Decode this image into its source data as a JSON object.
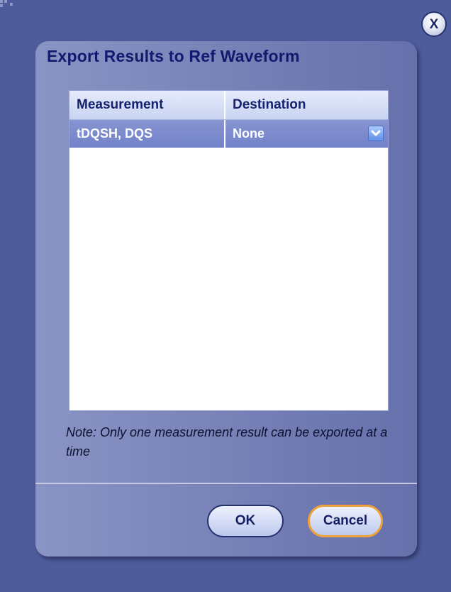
{
  "dialog": {
    "title": "Export Results to Ref Waveform",
    "close_label": "X"
  },
  "table": {
    "headers": [
      "Measurement",
      "Destination"
    ],
    "rows": [
      {
        "measurement": "tDQSH, DQS",
        "destination": "None"
      }
    ]
  },
  "note": "Note: Only one measurement result can be exported at a time",
  "buttons": {
    "ok": "OK",
    "cancel": "Cancel"
  },
  "colors": {
    "background": "#4f5c9c",
    "dialog": "#7680b6",
    "title": "#111a6e",
    "selected_row": "#7382c8",
    "focus_border": "#f0a23a"
  }
}
